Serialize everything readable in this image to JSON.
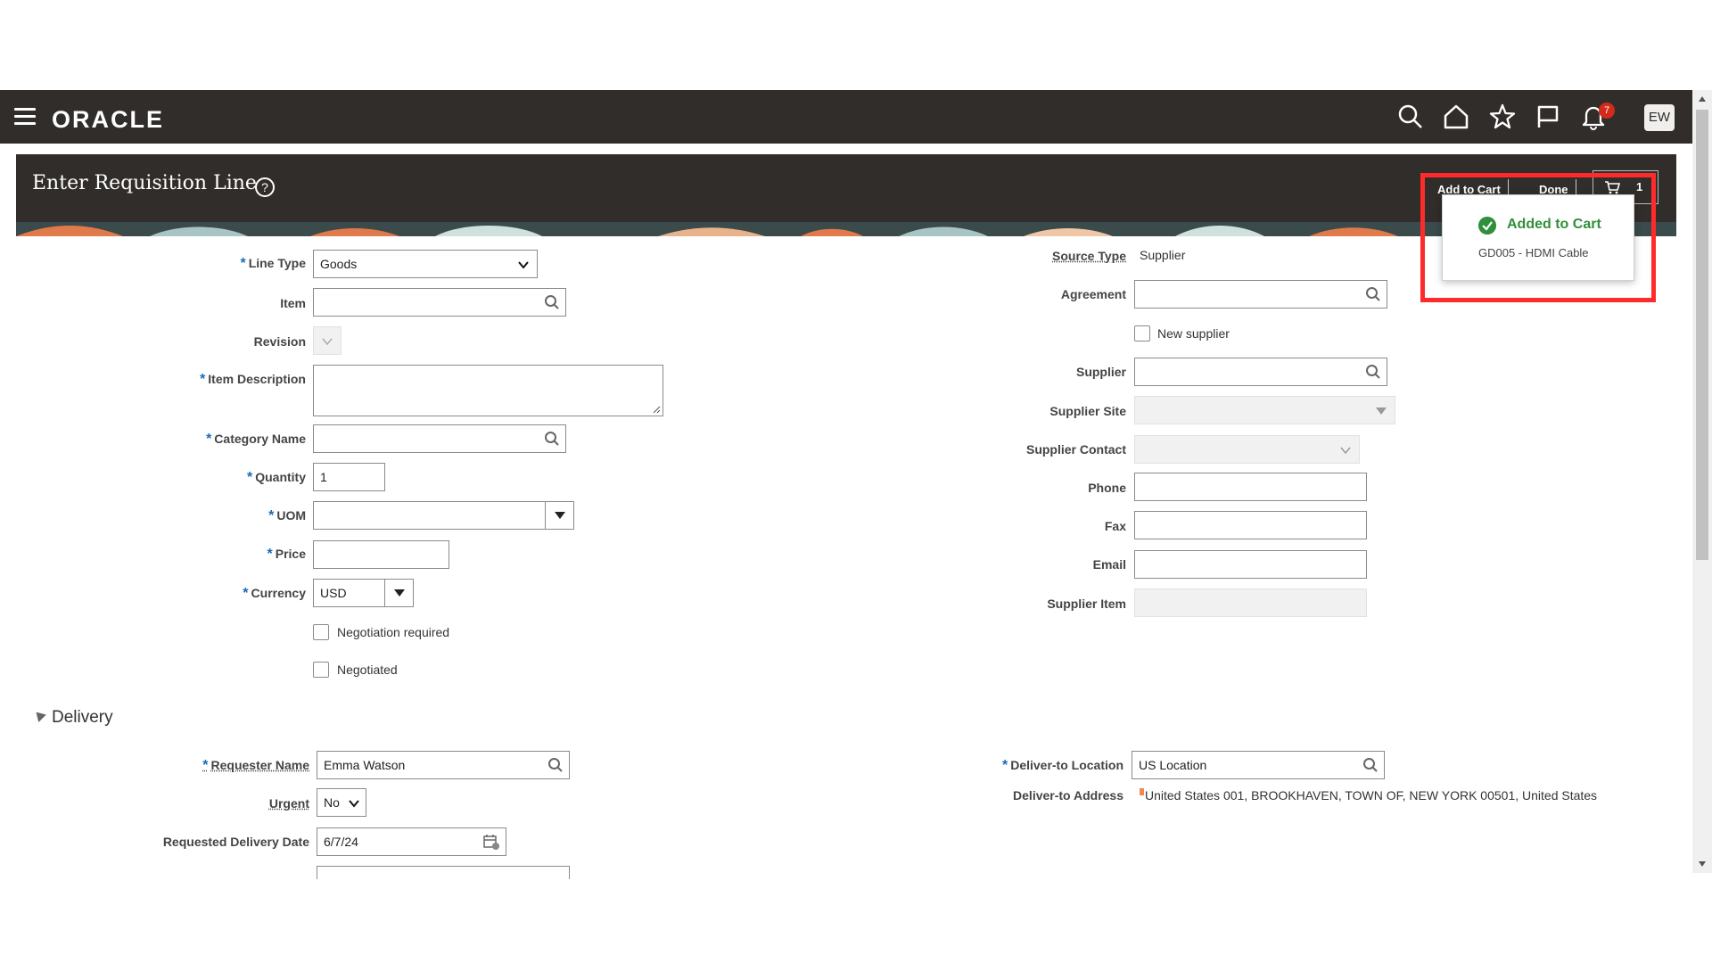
{
  "header": {
    "brand": "ORACLE",
    "notifications_count": "7",
    "user_initials": "EW"
  },
  "page": {
    "title": "Enter Requisition Line",
    "add_to_cart_label": "Add to Cart",
    "done_label": "Done",
    "cart_count": "1"
  },
  "popup": {
    "title": "Added to Cart",
    "subtitle": "GD005 - HDMI Cable"
  },
  "form_left": {
    "line_type_label": "Line Type",
    "line_type_value": "Goods",
    "item_label": "Item",
    "revision_label": "Revision",
    "item_description_label": "Item Description",
    "category_name_label": "Category Name",
    "quantity_label": "Quantity",
    "quantity_value": "1",
    "uom_label": "UOM",
    "price_label": "Price",
    "currency_label": "Currency",
    "currency_value": "USD",
    "negotiation_required_label": "Negotiation required",
    "negotiated_label": "Negotiated"
  },
  "form_right": {
    "source_type_label": "Source Type",
    "source_type_value": "Supplier",
    "agreement_label": "Agreement",
    "new_supplier_label": "New supplier",
    "supplier_label": "Supplier",
    "supplier_site_label": "Supplier Site",
    "supplier_contact_label": "Supplier Contact",
    "phone_label": "Phone",
    "fax_label": "Fax",
    "email_label": "Email",
    "supplier_item_label": "Supplier Item"
  },
  "delivery": {
    "section_label": "Delivery",
    "requester_name_label": "Requester Name",
    "requester_name_value": "Emma Watson",
    "urgent_label": "Urgent",
    "urgent_value": "No",
    "requested_delivery_date_label": "Requested Delivery Date",
    "requested_delivery_date_value": "6/7/24",
    "deliver_to_location_label": "Deliver-to Location",
    "deliver_to_location_value": "US  Location",
    "deliver_to_address_label": "Deliver-to Address",
    "deliver_to_address_value": "United States 001, BROOKHAVEN, TOWN OF, NEW YORK 00501, United States"
  },
  "colors": {
    "header_bg": "#312d2a",
    "required_asterisk": "#1a6bb5",
    "success": "#2f8f3a",
    "highlight": "#ff2b2b"
  },
  "icons": [
    "hamburger-icon",
    "search-icon",
    "home-icon",
    "star-icon",
    "flag-icon",
    "bell-icon",
    "help-icon",
    "cart-icon",
    "magnifier-icon",
    "chevron-down-icon",
    "calendar-icon",
    "check-circle-icon"
  ]
}
